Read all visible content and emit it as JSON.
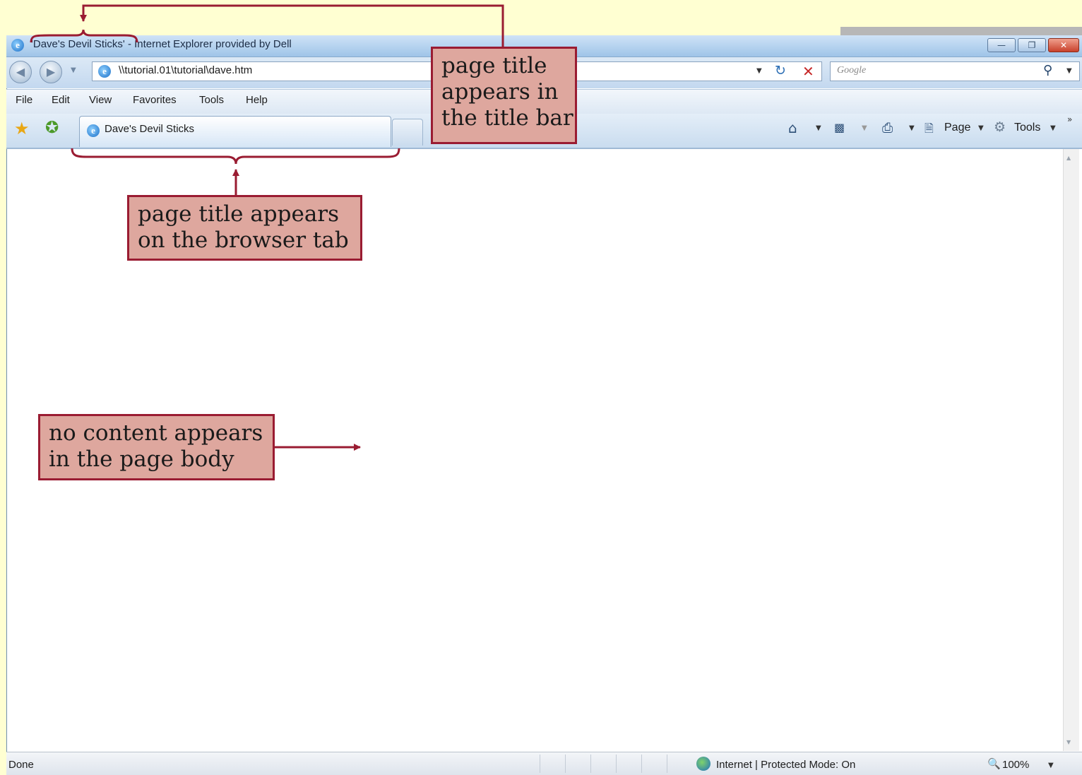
{
  "browser": {
    "title_bar_text": "'Dave's Devil Sticks' - Internet Explorer provided by Dell",
    "address": "\\\\tutorial.01\\tutorial\\dave.htm",
    "search_placeholder": "Google",
    "menu": [
      "File",
      "Edit",
      "View",
      "Favorites",
      "Tools",
      "Help"
    ],
    "tab_title": "Dave's Devil Sticks",
    "command_page_label": "Page",
    "command_tools_label": "Tools",
    "status_left": "Done",
    "status_zone": "Internet | Protected Mode: On",
    "zoom_level": "100%"
  },
  "icons": {
    "back": "back-arrow-icon",
    "forward": "forward-arrow-icon",
    "refresh": "refresh-icon",
    "stop": "stop-icon",
    "search": "search-icon",
    "favorites": "favorites-star-icon",
    "add_favorites": "add-favorites-icon",
    "home": "home-icon",
    "feeds": "feeds-icon",
    "print": "print-icon",
    "page": "page-icon",
    "tools": "gear-icon",
    "internet_zone": "globe-icon",
    "zoom": "magnifier-icon"
  },
  "callouts": {
    "title_bar": [
      "page title",
      "appears in",
      "the title bar"
    ],
    "browser_tab": [
      "page title appears",
      "on the browser tab"
    ],
    "page_body": [
      "no content appears",
      "in the page body"
    ]
  },
  "colors": {
    "annotation_fill": "#dea79e",
    "annotation_border": "#9a1c32",
    "slide_background": "#ffffd2"
  }
}
